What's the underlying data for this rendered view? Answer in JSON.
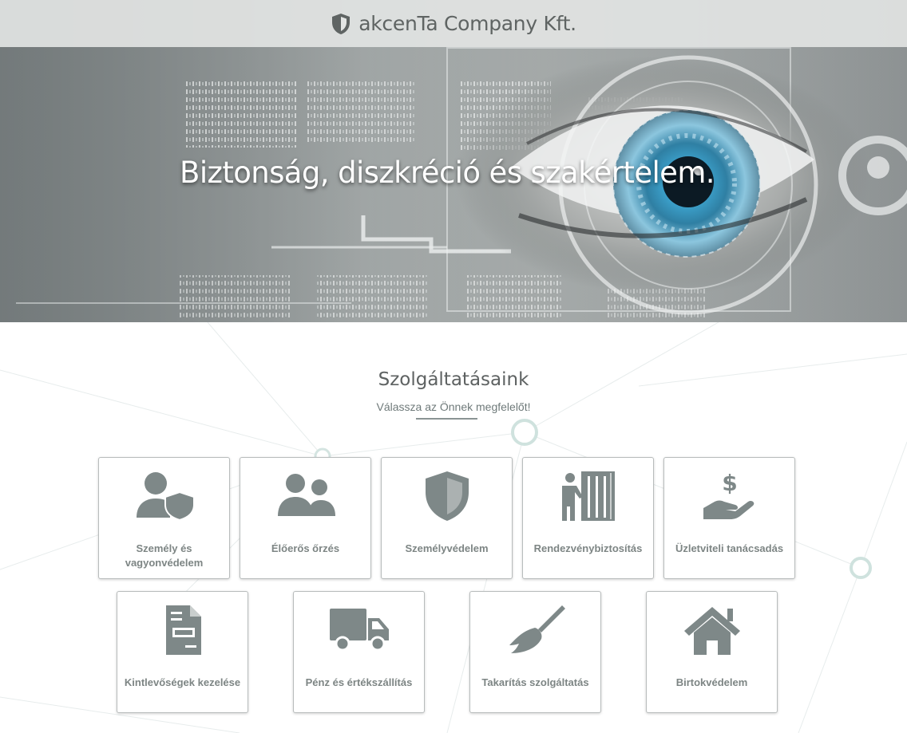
{
  "header": {
    "brand_name": "akcenTa Company Kft.",
    "logo_icon": "shield-icon"
  },
  "hero": {
    "headline": "Biztonság, diszkréció és szakértelem."
  },
  "services": {
    "title": "Szolgáltatásaink",
    "subtitle": "Válassza az Önnek megfelelőt!",
    "items": [
      {
        "label": "Személy és vagyonvédelem",
        "icon": "user-shield-icon"
      },
      {
        "label": "Élőerős őrzés",
        "icon": "users-icon"
      },
      {
        "label": "Személyvédelem",
        "icon": "shield-icon"
      },
      {
        "label": "Rendezvénybiztosítás",
        "icon": "person-curtain-icon"
      },
      {
        "label": "Üzletviteli tanácsadás",
        "icon": "hand-dollar-icon"
      },
      {
        "label": "Kintlevőségek kezelése",
        "icon": "invoice-document-icon"
      },
      {
        "label": "Pénz és értékszállítás",
        "icon": "truck-icon"
      },
      {
        "label": "Takarítás szolgáltatás",
        "icon": "broom-icon"
      },
      {
        "label": "Birtokvédelem",
        "icon": "home-icon"
      }
    ]
  },
  "colors": {
    "icon_gray": "#7e8888",
    "label_gray": "#7d8584",
    "eye_blue": "#2f7fa3",
    "accent_ring": "#b9d4cf"
  }
}
